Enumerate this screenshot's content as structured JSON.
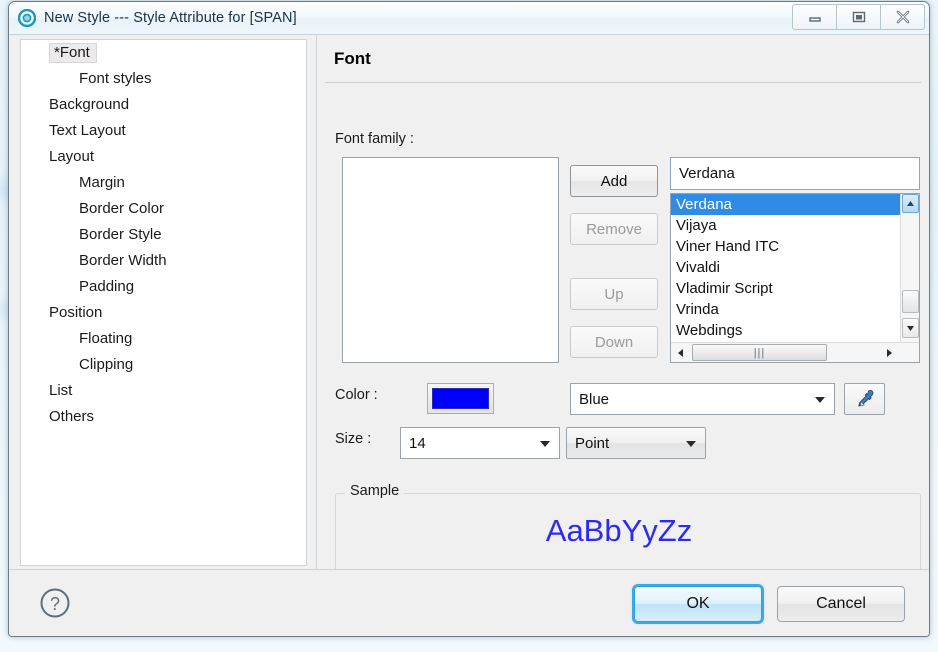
{
  "window": {
    "title": "New Style --- Style Attribute for [SPAN]",
    "icon": "style-target-icon",
    "controls": {
      "minimize": "minimize-icon",
      "maximize": "maximize-icon",
      "close": "close-icon"
    }
  },
  "tree": {
    "items": [
      {
        "label": "*Font",
        "indent": 0,
        "selected": true
      },
      {
        "label": "Font styles",
        "indent": 1,
        "selected": false
      },
      {
        "label": "Background",
        "indent": 0,
        "selected": false
      },
      {
        "label": "Text Layout",
        "indent": 0,
        "selected": false
      },
      {
        "label": "Layout",
        "indent": 0,
        "selected": false
      },
      {
        "label": "Margin",
        "indent": 1,
        "selected": false
      },
      {
        "label": "Border Color",
        "indent": 1,
        "selected": false
      },
      {
        "label": "Border Style",
        "indent": 1,
        "selected": false
      },
      {
        "label": "Border Width",
        "indent": 1,
        "selected": false
      },
      {
        "label": "Padding",
        "indent": 1,
        "selected": false
      },
      {
        "label": "Position",
        "indent": 0,
        "selected": false
      },
      {
        "label": "Floating",
        "indent": 1,
        "selected": false
      },
      {
        "label": "Clipping",
        "indent": 1,
        "selected": false
      },
      {
        "label": "List",
        "indent": 0,
        "selected": false
      },
      {
        "label": "Others",
        "indent": 0,
        "selected": false
      }
    ]
  },
  "page": {
    "title": "Font",
    "font_family_label": "Font family :",
    "selected_families": [],
    "buttons": {
      "add": "Add",
      "remove": "Remove",
      "up": "Up",
      "down": "Down"
    },
    "font_input_value": "Verdana",
    "font_list": [
      {
        "name": "Verdana",
        "selected": true
      },
      {
        "name": "Vijaya",
        "selected": false
      },
      {
        "name": "Viner Hand ITC",
        "selected": false
      },
      {
        "name": "Vivaldi",
        "selected": false
      },
      {
        "name": "Vladimir Script",
        "selected": false
      },
      {
        "name": "Vrinda",
        "selected": false
      },
      {
        "name": "Webdings",
        "selected": false
      }
    ],
    "color_label": "Color :",
    "color_value": "Blue",
    "color_swatch_hex": "#0000FF",
    "eyedropper": "eyedropper-icon",
    "size_label": "Size :",
    "size_value": "14",
    "unit_value": "Point",
    "sample_legend": "Sample",
    "sample_text": "AaBbYyZz",
    "sample_color_hex": "#2B2BF5",
    "selection_hex": "#2E8BE6"
  },
  "footer": {
    "help": "help-icon",
    "ok": "OK",
    "cancel": "Cancel"
  }
}
